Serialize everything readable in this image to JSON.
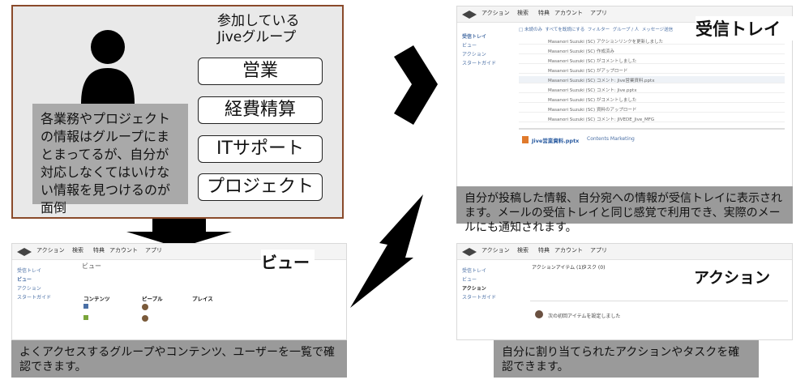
{
  "left_panel": {
    "heading": "参加している\nJiveグループ",
    "groups": [
      "営業",
      "経費精算",
      "ITサポート",
      "プロジェクト"
    ],
    "description": "各業務やプロジェクトの情報はグループにまとまってるが、自分が対応しなくてはいけない情報を見つけるのが面倒"
  },
  "nav": [
    "アクション",
    "検索",
    "特典",
    "アカウント",
    "アプリ"
  ],
  "inbox": {
    "title": "受信トレイ",
    "sidebar": [
      "受信トレイ",
      "ビュー",
      "アクション",
      "スタートガイド"
    ],
    "toolbar": [
      "□ 未読のみ",
      "すべてを既読にする",
      "フィルター",
      "グループ / 人",
      "メッセージ送信"
    ],
    "rows": [
      "Masanori Suzuki (SC) アクションリンクを更新しました",
      "Masanori Suzuki (SC) 作成済み",
      "Masanori Suzuki (SC) がコメントしました",
      "Masanori Suzuki (SC) がアップロード",
      "Masanori Suzuki (SC) コメント: Jive営業資料.pptx",
      "Masanori Suzuki (SC) コメント: Jive.pptx",
      "Masanori Suzuki (SC) がコメントしました",
      "Masanori Suzuki (SC) 資料のアップロード",
      "Masanori Suzuki (SC) コメント: JIVEDE_Jive_MFG"
    ],
    "detail_title": "Jive営業資料.pptx",
    "detail_tag": "Contents Marketing",
    "description": "自分が投稿した情報、自分宛への情報が受信トレイに表示されます。メールの受信トレイと同じ感覚で利用でき、実際のメールにも通知されます。"
  },
  "view": {
    "title": "ビュー",
    "header": "ビュー",
    "sidebar": [
      "受信トレイ",
      "ビュー",
      "アクション",
      "スタートガイド"
    ],
    "columns": [
      "コンテンツ",
      "ピープル",
      "プレイス"
    ],
    "description": "よくアクセスするグループやコンテンツ、ユーザーを一覧で確認できます。"
  },
  "action": {
    "title": "アクション",
    "tabs": [
      "アクションアイテム (1)",
      "タスク (0)"
    ],
    "sidebar": [
      "受信トレイ",
      "ビュー",
      "アクション",
      "スタートガイド"
    ],
    "item": "次の初回アイテムを設定しました",
    "description": "自分に割り当てられたアクションやタスクを確認できます。"
  },
  "colors": {
    "panel_border": "#8a4a2a",
    "panel_bg": "#e9e9e9",
    "label_bg": "#9a9a9a",
    "arrow": "#000000"
  }
}
